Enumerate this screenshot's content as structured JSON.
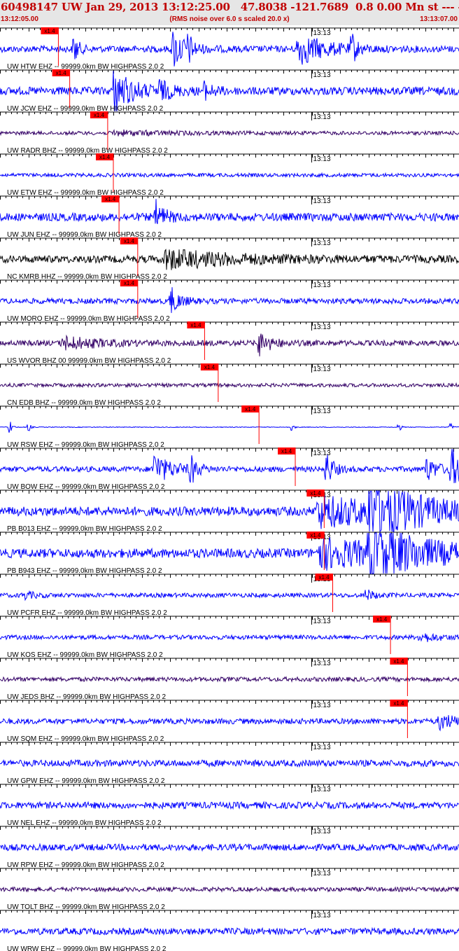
{
  "header": {
    "title": "60498147 UW Jan 29, 2013 13:12:25.00   47.8038 -121.7689  0.8 0.00 Mn st --- -- --   -1",
    "start_time": "13:12:05.00",
    "noise_note": "(RMS noise over 6.0 s scaled 20.0 x)",
    "end_time": "13:13:07.00"
  },
  "colors": {
    "header_bg": "#e6e6e6",
    "header_text": "#c00000",
    "blue_trace": "#0000ff",
    "purple_trace": "#330066",
    "black_trace": "#000000",
    "pick_marker": "#ff0000"
  },
  "chart_data": {
    "type": "line",
    "x_axis": {
      "start": "13:12:05.00",
      "end": "13:13:07.00",
      "minute_tick_label": "13:13",
      "minute_tick_time": "13:13:00"
    },
    "series": [
      {
        "name": "UW HTW EHZ -- 99999.0km BW  HIGHPASS  2.0  2",
        "color": "#0000ff",
        "pick": "x1.4",
        "pick_time": "13:12:15.3",
        "noise": 0.18,
        "bursts": [
          [
            13.0,
            0.7,
            1.0
          ],
          [
            30.5,
            2.2,
            1.1
          ],
          [
            33.2,
            0.6,
            0.7
          ],
          [
            52.5,
            4.5,
            0.9
          ],
          [
            62.0,
            0.8,
            0.9
          ]
        ]
      },
      {
        "name": "UW JCW EHZ -- 99999.0km BW  HIGHPASS  2.0  2",
        "color": "#0000ff",
        "pick": "x1.4",
        "pick_time": "13:12:17.3",
        "noise": 0.22,
        "bursts": [
          [
            20.0,
            3.0,
            1.3
          ],
          [
            28.0,
            2.0,
            0.5
          ],
          [
            36.0,
            1.5,
            0.4
          ]
        ]
      },
      {
        "name": "UW RADR BHZ -- 99999.0km BW  HIGHPASS  2.0  2",
        "color": "#330066",
        "pick": "x1.4",
        "pick_time": "13:12:24.0",
        "noise": 0.1,
        "bursts": [
          [
            20.0,
            10.0,
            0.12
          ]
        ]
      },
      {
        "name": "UW ETW EHZ -- 99999.0km BW  HIGHPASS  2.0  2",
        "color": "#0000ff",
        "pick": "x1.4",
        "pick_time": "13:12:25.0",
        "noise": 0.1,
        "bursts": []
      },
      {
        "name": "UW JUN EHZ -- 99999.0km BW  HIGHPASS  2.0  2",
        "color": "#0000ff",
        "pick": "x1.4",
        "pick_time": "13:12:26.0",
        "noise": 0.22,
        "bursts": [
          [
            27.5,
            1.5,
            0.8
          ]
        ]
      },
      {
        "name": "NC KMRB HHZ -- 99999.0km BW  HIGHPASS  2.0  2",
        "color": "#000000",
        "pick": "x1.4",
        "pick_time": "13:12:29.3",
        "noise": 0.2,
        "bursts": [
          [
            29.0,
            12.0,
            0.5
          ]
        ]
      },
      {
        "name": "UW MORO EHZ -- 99999.0km BW  HIGHPASS  2.0  2",
        "color": "#0000ff",
        "pick": "x1.4",
        "pick_time": "13:12:29.3",
        "noise": 0.15,
        "bursts": [
          [
            30.0,
            1.5,
            0.8
          ]
        ]
      },
      {
        "name": "US WVOR BHZ 00 99999.0km BW  HIGHPASS  2.0  2",
        "color": "#330066",
        "pick": "x1.4",
        "pick_time": "13:12:41.1",
        "noise": 0.15,
        "bursts": [
          [
            11.0,
            6.0,
            0.35
          ],
          [
            45.5,
            2.0,
            0.7
          ]
        ]
      },
      {
        "name": "CN EDB BHZ -- 99999.0km BW  HIGHPASS  2.0  2",
        "color": "#330066",
        "pick": "x1.4",
        "pick_time": "13:12:43.5",
        "noise": 0.1,
        "bursts": []
      },
      {
        "name": "UW RSW EHZ -- 99999.0km BW  HIGHPASS  2.0  2",
        "color": "#0000ff",
        "pick": "x1.4",
        "pick_time": "13:12:50.7",
        "noise": 0.02,
        "bursts": [
          [
            1.7,
            0.3,
            0.6
          ],
          [
            5.0,
            0.3,
            0.4
          ],
          [
            51.5,
            0.3,
            0.3
          ],
          [
            70.3,
            0.3,
            0.4
          ],
          [
            79.5,
            0.3,
            0.3
          ]
        ]
      },
      {
        "name": "UW BOW EHZ -- 99999.0km BW  HIGHPASS  2.0  2",
        "color": "#0000ff",
        "pick": "x1.4",
        "pick_time": "13:12:57.1",
        "noise": 0.15,
        "bursts": [
          [
            27.0,
            3.0,
            0.9
          ],
          [
            33.5,
            1.0,
            0.9
          ],
          [
            57.5,
            1.2,
            1.0
          ],
          [
            75.0,
            2.0,
            0.7
          ],
          [
            79.5,
            2.5,
            1.1
          ]
        ]
      },
      {
        "name": "PB B013 EHZ -- 99999.0km BW  HIGHPASS  2.0  2",
        "color": "#0000ff",
        "pick": "x1.4",
        "pick_time": "13:13:02.2",
        "noise": 0.25,
        "bursts": [
          [
            56.0,
            15.0,
            0.8
          ],
          [
            65.0,
            8.0,
            1.4
          ]
        ]
      },
      {
        "name": "PB B943 EHZ -- 99999.0km BW  HIGHPASS  2.0  2",
        "color": "#0000ff",
        "pick": "x1.4",
        "pick_time": "13:13:02.2",
        "noise": 0.25,
        "bursts": [
          [
            56.0,
            15.0,
            0.8
          ],
          [
            65.0,
            8.0,
            1.4
          ]
        ]
      },
      {
        "name": "UW PCFR EHZ -- 99999.0km BW  HIGHPASS  2.0  2",
        "color": "#0000ff",
        "pick": "x1.4",
        "pick_time": "13:13:03.7",
        "noise": 0.12,
        "bursts": [
          [
            4.0,
            2.0,
            0.2
          ],
          [
            64.5,
            1.5,
            0.3
          ]
        ]
      },
      {
        "name": "UW KOS EHZ -- 99999.0km BW  HIGHPASS  2.0  2",
        "color": "#0000ff",
        "pick": "x1.4",
        "pick_time": "13:13:13.9",
        "noise": 0.12,
        "bursts": [
          [
            74.0,
            3.0,
            0.25
          ]
        ]
      },
      {
        "name": "UW JEDS BHZ -- 99999.0km BW  HIGHPASS  2.0  2",
        "color": "#330066",
        "pick": "x1.4",
        "pick_time": "13:13:16.9",
        "noise": 0.12,
        "bursts": []
      },
      {
        "name": "UW SQM EHZ -- 99999.0km BW  HIGHPASS  2.0  2",
        "color": "#0000ff",
        "pick": "x1.4",
        "pick_time": "13:13:16.9",
        "noise": 0.15,
        "bursts": [
          [
            77.5,
            2.5,
            0.45
          ]
        ]
      },
      {
        "name": "UW GPW EHZ -- 99999.0km BW  HIGHPASS  2.0  2",
        "color": "#0000ff",
        "pick": "",
        "pick_time": "",
        "noise": 0.18,
        "bursts": []
      },
      {
        "name": "UW NEL EHZ -- 99999.0km BW  HIGHPASS  2.0  2",
        "color": "#0000ff",
        "pick": "",
        "pick_time": "",
        "noise": 0.18,
        "bursts": []
      },
      {
        "name": "UW RPW EHZ -- 99999.0km BW  HIGHPASS  2.0  2",
        "color": "#0000ff",
        "pick": "",
        "pick_time": "",
        "noise": 0.18,
        "bursts": []
      },
      {
        "name": "UW TOLT BHZ -- 99999.0km BW  HIGHPASS  2.0  2",
        "color": "#330066",
        "pick": "",
        "pick_time": "",
        "noise": 0.12,
        "bursts": []
      },
      {
        "name": "UW WRW EHZ -- 99999.0km BW  HIGHPASS  2.0  2",
        "color": "#0000ff",
        "pick": "",
        "pick_time": "",
        "noise": 0.18,
        "bursts": []
      }
    ]
  }
}
